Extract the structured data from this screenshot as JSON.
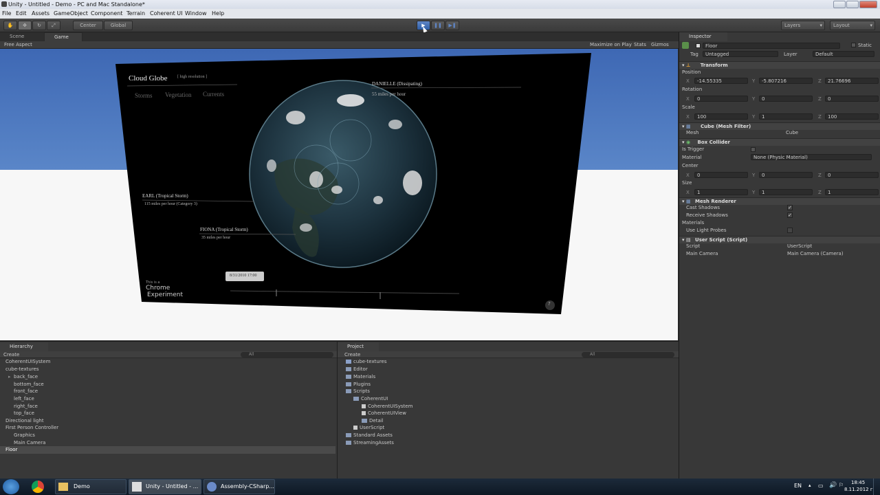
{
  "window": {
    "title": "Unity - Untitled - Demo - PC and Mac Standalone*"
  },
  "menu": [
    "File",
    "Edit",
    "Assets",
    "GameObject",
    "Component",
    "Terrain",
    "Coherent UI",
    "Window",
    "Help"
  ],
  "toolbar": {
    "center": "Center",
    "global": "Global",
    "layers": "Layers",
    "layout": "Layout"
  },
  "tabs": {
    "scene": "Scene",
    "game": "Game",
    "inspector": "Inspector",
    "hierarchy": "Hierarchy",
    "project": "Project"
  },
  "game": {
    "aspect": "Free Aspect",
    "maximize": "Maximize on Play",
    "stats": "Stats",
    "gizmos": "Gizmos"
  },
  "globe": {
    "title": "Cloud Globe",
    "res": "[ high resolution ]",
    "tabs": [
      "Storms",
      "Vegetation",
      "Currents"
    ],
    "danielle": "DANIELLE (Dissipating)",
    "danielle_speed": "55 miles per hour",
    "earl": "EARL (Tropical Storm)",
    "earl_speed": "115 miles per hour (Category 3)",
    "fiona": "FIONA (Tropical Storm)",
    "fiona_speed": "35 miles per hour",
    "date": "8/31/2010 17:00",
    "chrome_small": "This is a",
    "chrome1": "Chrome",
    "chrome2": "Experiment",
    "help": "?"
  },
  "inspector": {
    "object": "Floor",
    "static": "Static",
    "tag_label": "Tag",
    "tag": "Untagged",
    "layer_label": "Layer",
    "layer": "Default",
    "transform": "Transform",
    "position": "Position",
    "rotation": "Rotation",
    "scale": "Scale",
    "pos": [
      "-14.55335",
      "-5.807216",
      "21.76696"
    ],
    "rot": [
      "0",
      "0",
      "0"
    ],
    "scl": [
      "100",
      "1",
      "100"
    ],
    "meshfilter": "Cube (Mesh Filter)",
    "mesh_label": "Mesh",
    "mesh": "Cube",
    "boxcollider": "Box Collider",
    "istrigger": "Is Trigger",
    "material_label": "Material",
    "material": "None (Physic Material)",
    "center": "Center",
    "center_vals": [
      "0",
      "0",
      "0"
    ],
    "size": "Size",
    "size_vals": [
      "1",
      "1",
      "1"
    ],
    "meshrenderer": "Mesh Renderer",
    "cast": "Cast Shadows",
    "receive": "Receive Shadows",
    "materials": "Materials",
    "lightprobes": "Use Light Probes",
    "userscript": "User Script (Script)",
    "script_label": "Script",
    "script": "UserScript",
    "camera_label": "Main Camera",
    "camera": "Main Camera (Camera)"
  },
  "hierarchy": {
    "create": "Create",
    "search": "All",
    "items": [
      "CoherentUISystem",
      "cube-textures",
      "back_face",
      "bottom_face",
      "front_face",
      "left_face",
      "right_face",
      "top_face",
      "Directional light",
      "First Person Controller",
      "Graphics",
      "Main Camera",
      "Floor"
    ]
  },
  "project": {
    "create": "Create",
    "search": "All",
    "items": [
      "cube-textures",
      "Editor",
      "Materials",
      "Plugins",
      "Scripts",
      "CoherentUI",
      "CoherentUISystem",
      "CoherentUIView",
      "Detail",
      "UserScript",
      "Standard Assets",
      "StreamingAssets"
    ]
  },
  "taskbar": {
    "demo": "Demo",
    "unity": "Unity - Untitled - ...",
    "assembly": "Assembly-CSharp...",
    "lang": "EN",
    "time": "18:45",
    "date": "8.11.2012 г."
  }
}
